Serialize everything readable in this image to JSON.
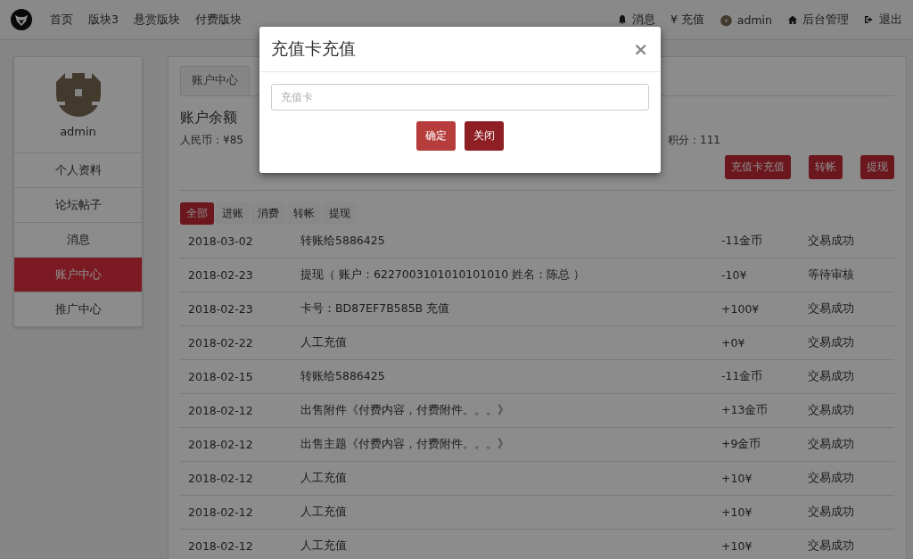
{
  "navbar": {
    "links": [
      "首页",
      "版块3",
      "悬赏版块",
      "付费版块"
    ],
    "right": [
      {
        "kind": "messages",
        "label": "消息"
      },
      {
        "kind": "recharge",
        "label": "¥ 充值"
      },
      {
        "kind": "account",
        "label": "admin"
      },
      {
        "kind": "admin",
        "label": "后台管理"
      },
      {
        "kind": "logout",
        "label": "退出"
      }
    ]
  },
  "sidebar": {
    "username": "admin",
    "items": [
      {
        "label": "个人资料",
        "selected": false
      },
      {
        "label": "论坛帖子",
        "selected": false
      },
      {
        "label": "消息",
        "selected": false
      },
      {
        "label": "账户中心",
        "selected": true
      },
      {
        "label": "推广中心",
        "selected": false
      }
    ]
  },
  "main": {
    "tabs": [
      {
        "label": "账户中心",
        "selected": true
      }
    ],
    "heading": "账户余额",
    "stats": [
      "人民币：¥85",
      "积分：111"
    ],
    "actions": [
      "充值卡充值",
      "转帐",
      "提现"
    ],
    "filters": [
      {
        "label": "全部",
        "selected": true
      },
      {
        "label": "进账",
        "selected": false
      },
      {
        "label": "消费",
        "selected": false
      },
      {
        "label": "转帐",
        "selected": false
      },
      {
        "label": "提现",
        "selected": false
      }
    ],
    "rows": [
      {
        "date": "2018-03-02",
        "description": "转账给5886425",
        "amount": "-11金币",
        "status": "交易成功"
      },
      {
        "date": "2018-02-23",
        "description": "提现（ 账户：6227003101010101010 姓名：陈总 ）",
        "amount": "-10¥",
        "status": "等待审核"
      },
      {
        "date": "2018-02-23",
        "description": "卡号：BD87EF7B585B 充值",
        "amount": "+100¥",
        "status": "交易成功"
      },
      {
        "date": "2018-02-22",
        "description": "人工充值",
        "amount": "+0¥",
        "status": "交易成功"
      },
      {
        "date": "2018-02-15",
        "description": "转账给5886425",
        "amount": "-11金币",
        "status": "交易成功"
      },
      {
        "date": "2018-02-12",
        "description": "出售附件《付费内容，付费附件。。。》",
        "amount": "+13金币",
        "status": "交易成功"
      },
      {
        "date": "2018-02-12",
        "description": "出售主题《付费内容，付费附件。。。》",
        "amount": "+9金币",
        "status": "交易成功"
      },
      {
        "date": "2018-02-12",
        "description": "人工充值",
        "amount": "+10¥",
        "status": "交易成功"
      },
      {
        "date": "2018-02-12",
        "description": "人工充值",
        "amount": "+10¥",
        "status": "交易成功"
      },
      {
        "date": "2018-02-12",
        "description": "人工充值",
        "amount": "+10¥",
        "status": "交易成功"
      }
    ]
  },
  "modal": {
    "title": "充值卡充值",
    "close": "×",
    "field": {
      "placeholder": "充值卡"
    },
    "buttons": [
      "确定",
      "关闭"
    ]
  }
}
